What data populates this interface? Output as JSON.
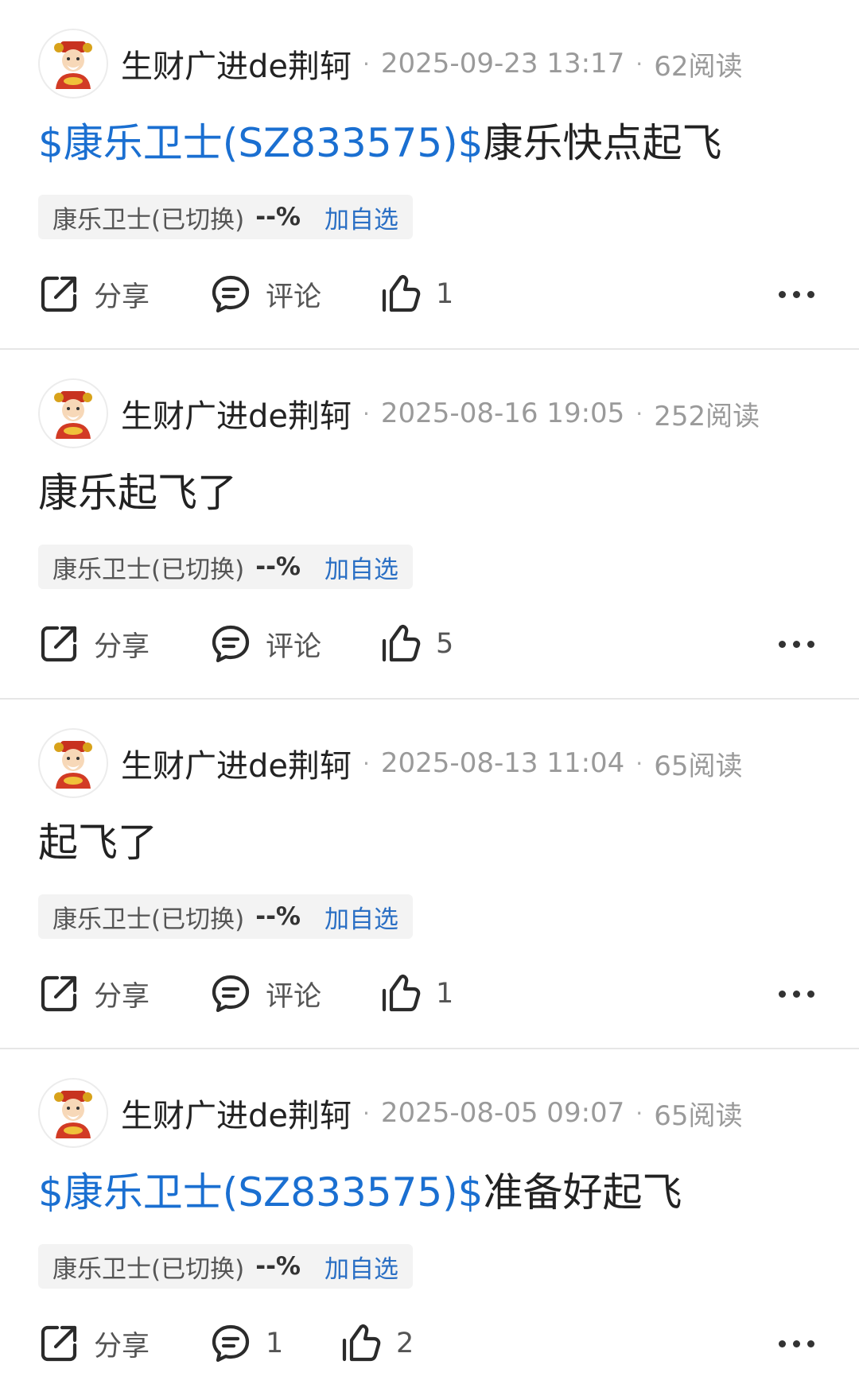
{
  "posts": [
    {
      "author": "生财广进de荆轲",
      "time": "2025-09-23 13:17",
      "reads": "62阅读",
      "link": "$康乐卫士(SZ833575)$",
      "text": "康乐快点起飞",
      "chip": {
        "name": "康乐卫士(已切换)",
        "pct": "--%",
        "add": "加自选"
      },
      "share": "分享",
      "comment": "评论",
      "likes": "1"
    },
    {
      "author": "生财广进de荆轲",
      "time": "2025-08-16 19:05",
      "reads": "252阅读",
      "link": "",
      "text": "康乐起飞了",
      "chip": {
        "name": "康乐卫士(已切换)",
        "pct": "--%",
        "add": "加自选"
      },
      "share": "分享",
      "comment": "评论",
      "likes": "5"
    },
    {
      "author": "生财广进de荆轲",
      "time": "2025-08-13 11:04",
      "reads": "65阅读",
      "link": "",
      "text": "起飞了",
      "chip": {
        "name": "康乐卫士(已切换)",
        "pct": "--%",
        "add": "加自选"
      },
      "share": "分享",
      "comment": "评论",
      "likes": "1"
    },
    {
      "author": "生财广进de荆轲",
      "time": "2025-08-05 09:07",
      "reads": "65阅读",
      "link": "$康乐卫士(SZ833575)$",
      "text": "准备好起飞",
      "chip": {
        "name": "康乐卫士(已切换)",
        "pct": "--%",
        "add": "加自选"
      },
      "share": "分享",
      "comment": "1",
      "likes": "2"
    }
  ],
  "meta_separator": "·",
  "icons": {
    "share": "share-icon",
    "comment": "comment-icon",
    "like": "thumbs-up-icon",
    "more": "more-icon"
  },
  "colors": {
    "link": "#1a6fd1",
    "add_watchlist": "#2a6fc4",
    "muted": "#9a9a9a",
    "chip_bg": "#f3f3f3"
  }
}
